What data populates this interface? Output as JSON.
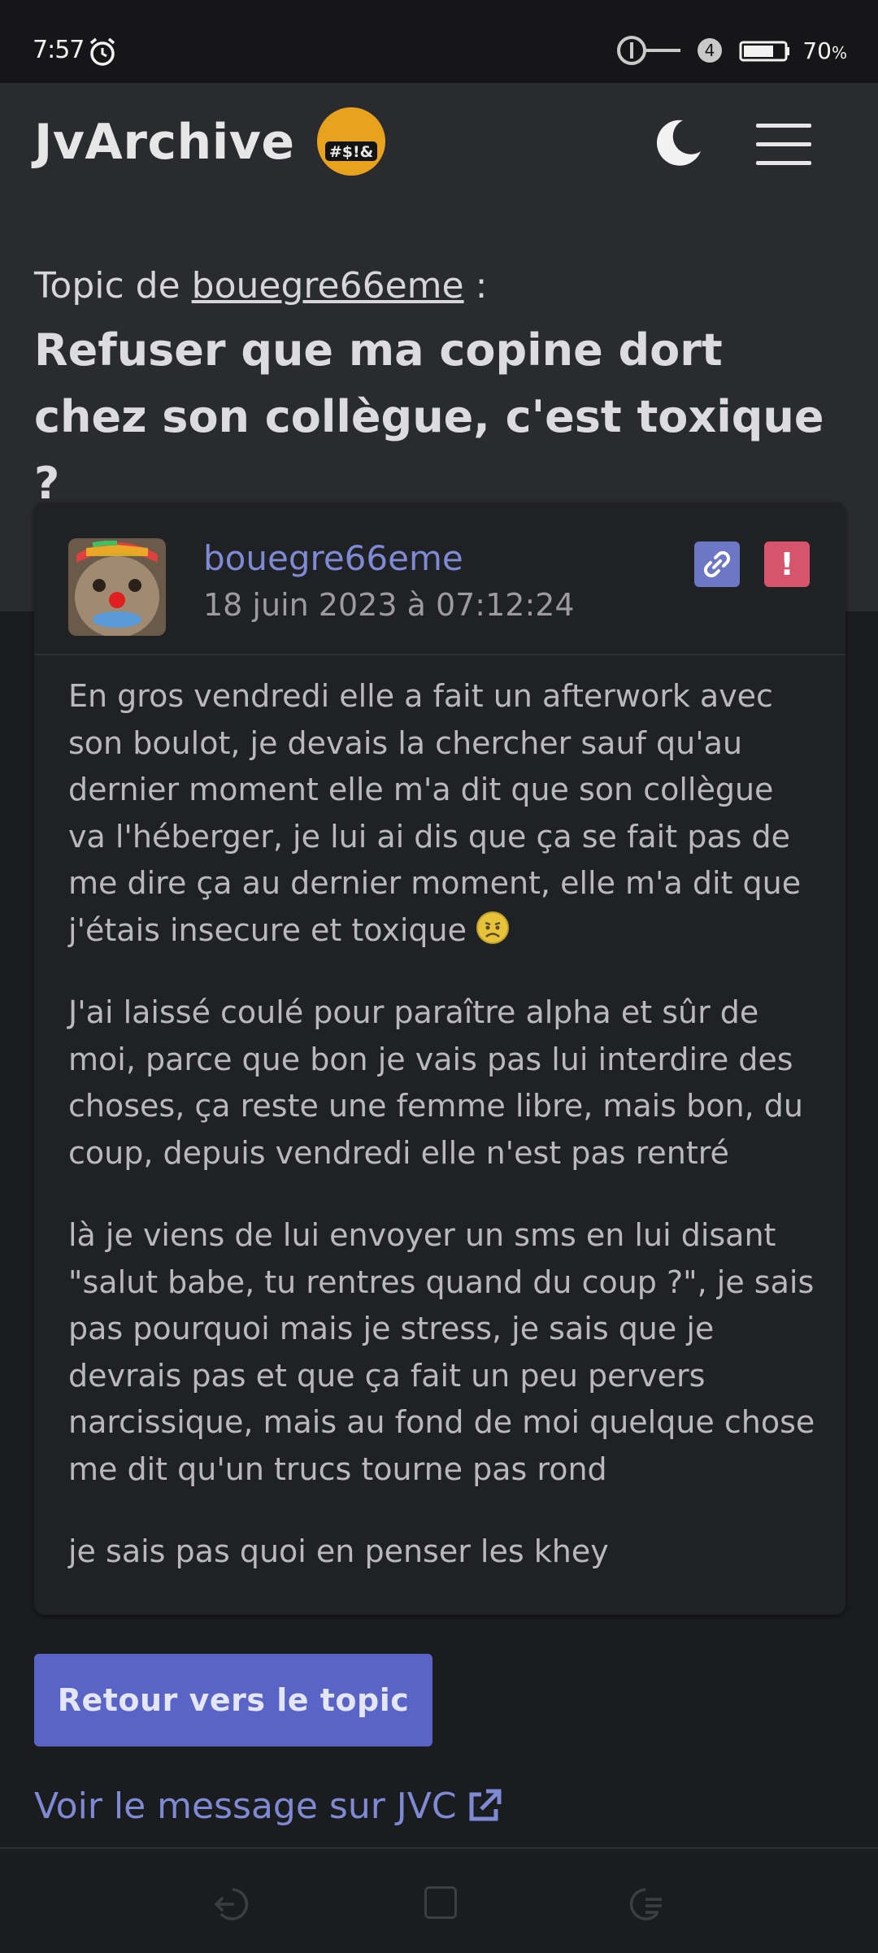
{
  "status_bar": {
    "time": "7:57",
    "notif_count": "4",
    "battery": "70"
  },
  "header": {
    "brand": "JvArchive",
    "emoji_text": "#$!&"
  },
  "topic": {
    "prefix": "Topic de",
    "author": "bouegre66eme",
    "suffix": ":",
    "title": "Refuser que ma copine dort chez son collègue, c'est toxique ?"
  },
  "post": {
    "author": "bouegre66eme",
    "date": "18 juin 2023 à 07:12:24",
    "paragraphs": [
      "En gros vendredi elle a fait un afterwork avec son boulot, je devais la chercher sauf qu'au dernier moment elle m'a dit que son collègue va l'héberger, je lui ai dis que ça se fait pas de me dire ça au dernier moment, elle m'a dit que j'étais insecure et toxique",
      "J'ai laissé coulé pour paraître alpha et sûr de moi, parce que bon je vais pas lui interdire des choses, ça reste une femme libre, mais bon, du coup, depuis vendredi elle n'est pas rentré",
      "là je viens de lui envoyer un sms en lui disant \"salut babe, tu rentres quand du coup ?\", je sais pas pourquoi mais je stress, je sais que je devrais pas et que ça fait un peu pervers narcissique, mais au fond de moi quelque chose me dit qu'un trucs tourne pas rond",
      "je sais pas quoi en penser les khey"
    ],
    "report_symbol": "!"
  },
  "actions": {
    "back_label": "Retour vers le topic",
    "jvc_label": "Voir le message sur JVC"
  },
  "colors": {
    "accent": "#7f8ad4",
    "button": "#5a64c6",
    "report": "#d6556d",
    "link_button": "#6c78c6"
  }
}
